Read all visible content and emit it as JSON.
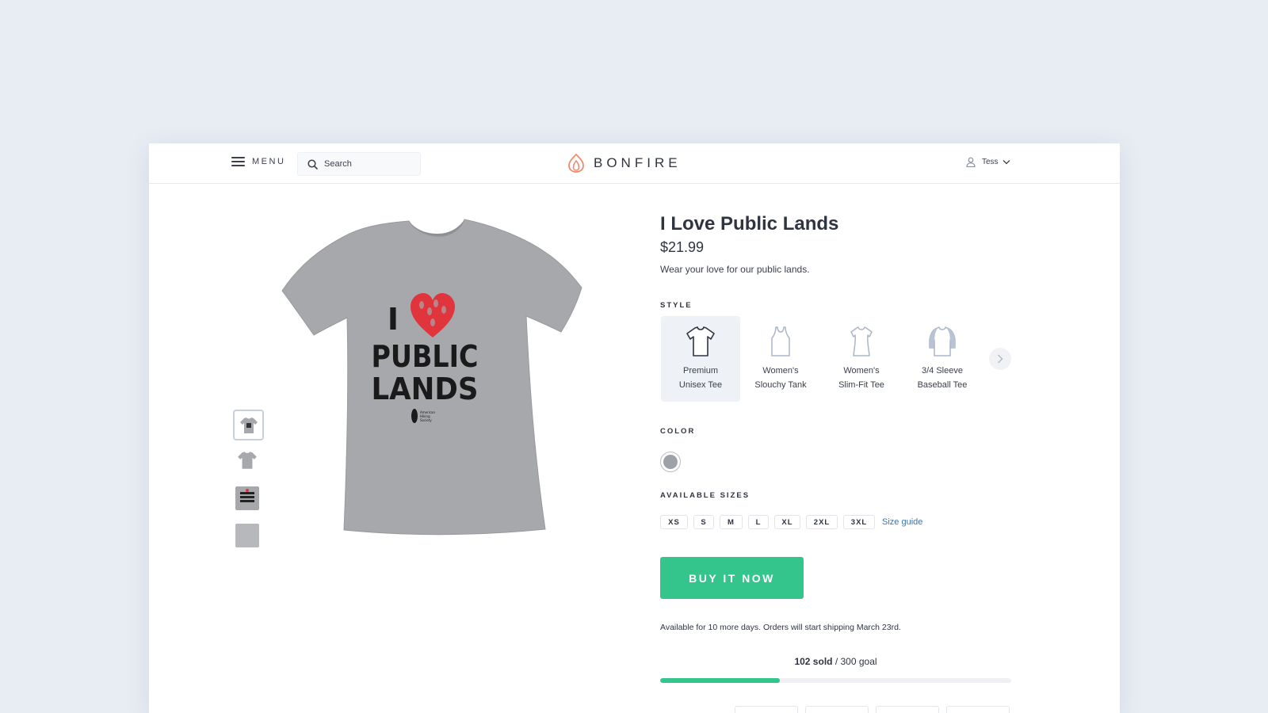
{
  "header": {
    "menu_label": "MENU",
    "search_placeholder": "Search",
    "brand": "BONFIRE",
    "user_name": "Tess"
  },
  "product": {
    "title": "I Love Public Lands",
    "price": "$21.99",
    "description": "Wear your love for our public lands.",
    "shirt_print": {
      "line1": "I",
      "line2": "PUBLIC",
      "line3": "LANDS",
      "tag_line1": "American",
      "tag_line2": "Hiking",
      "tag_line3": "Society"
    }
  },
  "style_section": {
    "label": "STYLE",
    "options": [
      {
        "line1": "Premium",
        "line2": "Unisex Tee",
        "icon": "tee-icon",
        "selected": true
      },
      {
        "line1": "Women's",
        "line2": "Slouchy Tank",
        "icon": "tank-icon",
        "selected": false
      },
      {
        "line1": "Women's",
        "line2": "Slim-Fit Tee",
        "icon": "slim-tee-icon",
        "selected": false
      },
      {
        "line1": "3/4 Sleeve",
        "line2": "Baseball Tee",
        "icon": "baseball-tee-icon",
        "selected": false
      }
    ]
  },
  "color_section": {
    "label": "COLOR",
    "swatch_color": "#9ea1a8"
  },
  "sizes_section": {
    "label": "AVAILABLE SIZES",
    "sizes": [
      "XS",
      "S",
      "M",
      "L",
      "XL",
      "2XL",
      "3XL"
    ],
    "size_guide": "Size guide"
  },
  "buy_button": "BUY IT NOW",
  "availability": "Available for 10 more days. Orders will start shipping March 23rd.",
  "goal": {
    "sold_text": "102 sold",
    "goal_text": " / 300 goal",
    "sold": 102,
    "target": 300
  },
  "colors": {
    "accent": "#33c58b",
    "brand_flame": "#f08a6e",
    "link": "#3d73a8"
  }
}
